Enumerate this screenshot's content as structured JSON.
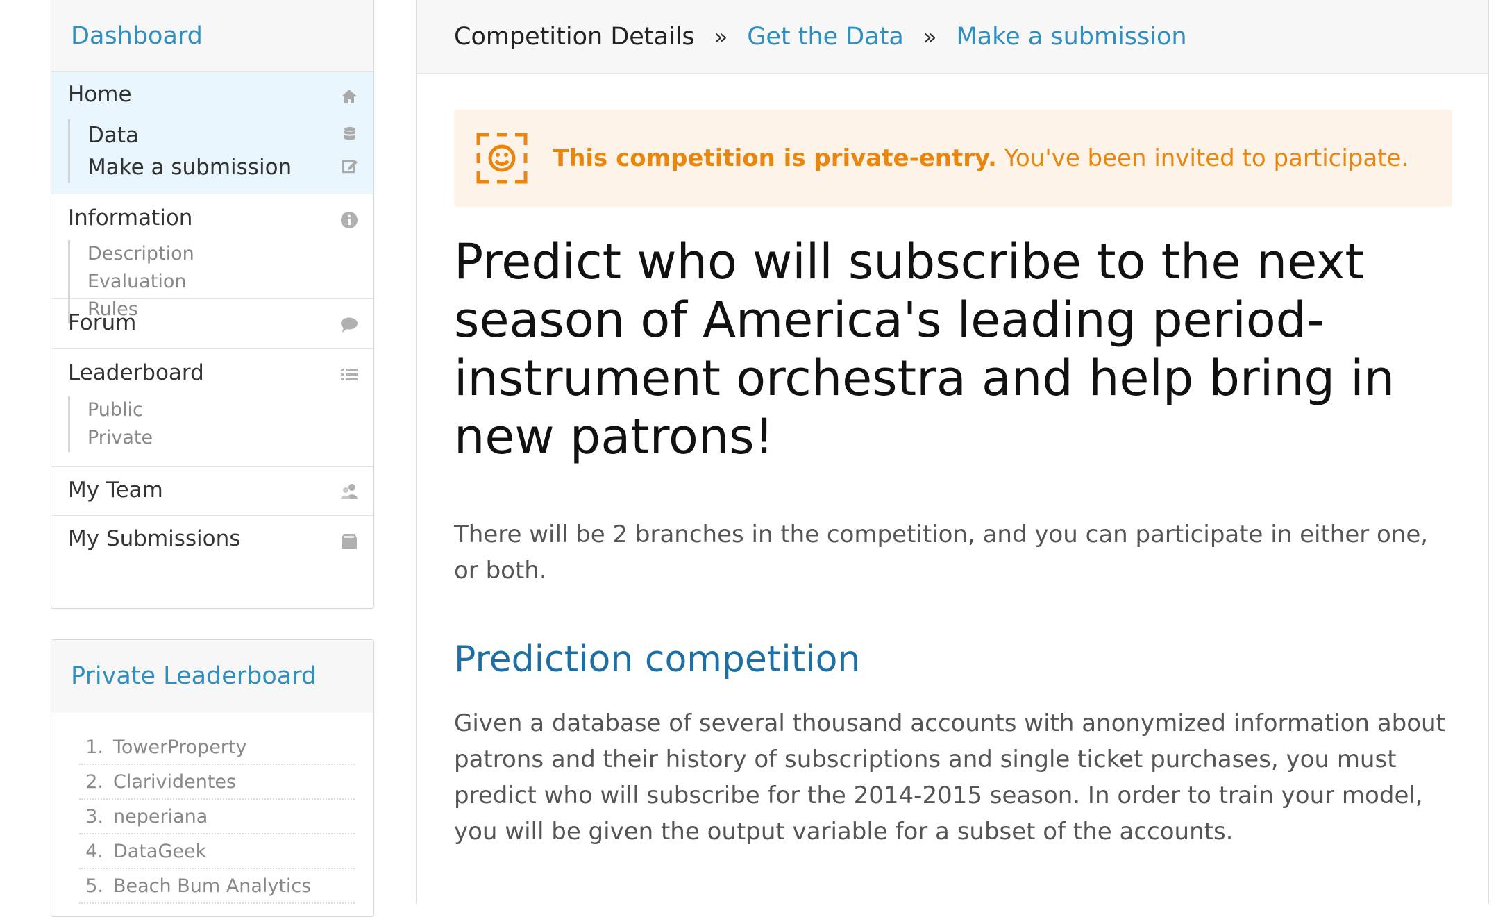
{
  "sidebar": {
    "title": "Dashboard",
    "sections": {
      "home": {
        "label": "Home",
        "icon": "home-icon",
        "subitems": [
          "Data",
          "Make a submission"
        ]
      },
      "information": {
        "label": "Information",
        "icon": "info-icon",
        "subitems": [
          "Description",
          "Evaluation",
          "Rules"
        ]
      },
      "forum": {
        "label": "Forum",
        "icon": "chat-bubble-icon"
      },
      "leaderboard": {
        "label": "Leaderboard",
        "icon": "list-icon",
        "subitems": [
          "Public",
          "Private"
        ]
      },
      "team": {
        "label": "My Team",
        "icon": "team-icon"
      },
      "submissions": {
        "label": "My Submissions",
        "icon": "inbox-icon"
      }
    }
  },
  "private_leaderboard": {
    "title": "Private Leaderboard",
    "entries": [
      {
        "rank": "1.",
        "name": "TowerProperty"
      },
      {
        "rank": "2.",
        "name": "Clarividentes"
      },
      {
        "rank": "3.",
        "name": "neperiana"
      },
      {
        "rank": "4.",
        "name": "DataGeek"
      },
      {
        "rank": "5.",
        "name": "Beach Bum Analytics"
      }
    ]
  },
  "breadcrumb": {
    "current": "Competition Details",
    "separator": "»",
    "links": [
      "Get the Data",
      "Make a submission"
    ]
  },
  "alert": {
    "strong": "This competition is private-entry.",
    "text": " You've been invited to participate.",
    "icon": "smiley-face-icon",
    "color": "#e8860f",
    "background": "#fdf3e8"
  },
  "content": {
    "headline": "Predict who will subscribe to the next season of America's leading period-instrument orchestra and help bring in new patrons!",
    "intro": "There will be 2 branches in the competition, and you can participate in either one, or both.",
    "section_title": "Prediction competition",
    "section_body": "Given a database of several thousand accounts with anonymized information about patrons and their history of subscriptions and single ticket purchases, you must predict who will subscribe for the 2014-2015 season. In order to train your model, you will be given the output variable for a subset of the accounts."
  },
  "colors": {
    "link": "#2f8fc0",
    "section_heading": "#1d6fa5",
    "active_section_bg": "#e9f6fd"
  }
}
